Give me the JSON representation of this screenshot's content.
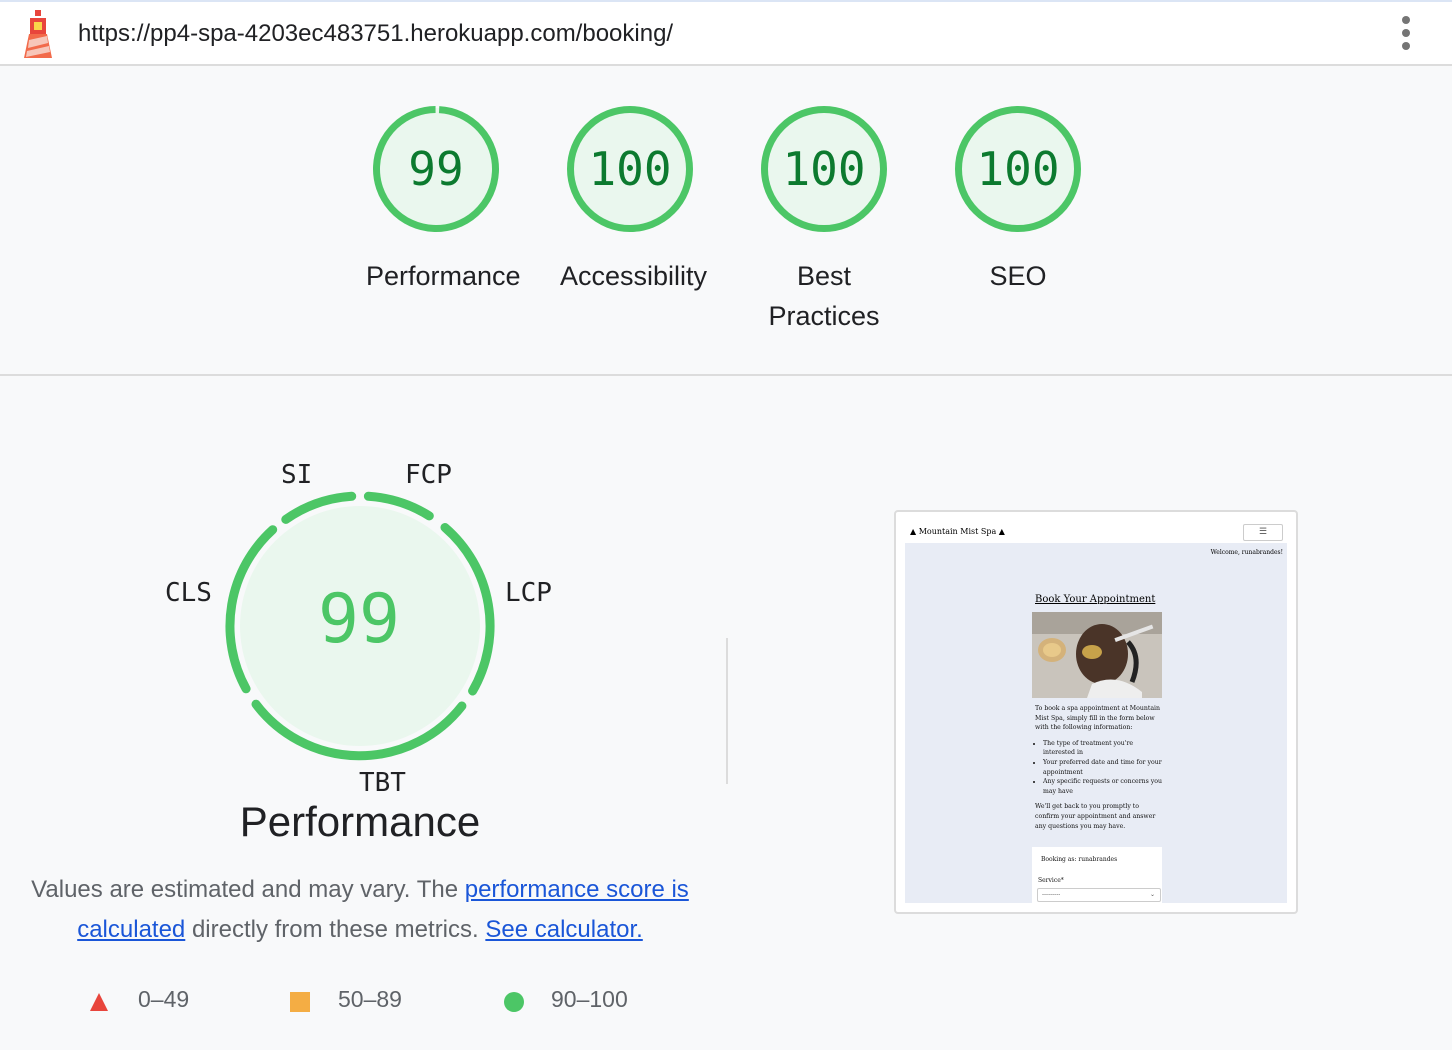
{
  "header": {
    "url": "https://pp4-spa-4203ec483751.herokuapp.com/booking/",
    "logo_icon": "lighthouse-icon",
    "menu_icon": "more-vert-icon"
  },
  "scores": [
    {
      "value": 99,
      "label": "Performance"
    },
    {
      "value": 100,
      "label": "Accessibility"
    },
    {
      "value": 100,
      "label": "Best Practices"
    },
    {
      "value": 100,
      "label": "SEO"
    }
  ],
  "colors": {
    "pass": "#4cc666",
    "pass_text": "#0c7a2f",
    "pass_fill": "#eaf7ee",
    "link": "#1a56d8",
    "fail": "#e8453c",
    "average": "#f4ad44"
  },
  "performance": {
    "score": 99,
    "title": "Performance",
    "metrics": {
      "si": "SI",
      "fcp": "FCP",
      "lcp": "LCP",
      "tbt": "TBT",
      "cls": "CLS"
    },
    "description": {
      "before": "Values are estimated and may vary. The ",
      "link1": "performance score is calculated",
      "middle": " directly from these metrics. ",
      "link2": "See calculator."
    }
  },
  "legend": [
    {
      "range": "0–49",
      "shape": "triangle"
    },
    {
      "range": "50–89",
      "shape": "square"
    },
    {
      "range": "90–100",
      "shape": "circle"
    }
  ],
  "screenshot": {
    "brand": "Mountain Mist Spa",
    "menu_glyph": "☰",
    "welcome": "Welcome, runabrandes!",
    "heading": "Book Your Appointment",
    "intro": "To book a spa appointment at Mountain Mist Spa, simply fill in the form below with the following information:",
    "bullets": [
      "The type of treatment you're interested in",
      "Your preferred date and time for your appointment",
      "Any specific requests or concerns you may have"
    ],
    "outro": "We'll get back to you promptly to confirm your appointment and answer any questions you may have.",
    "booking_as": "Booking as: runabrandes",
    "service_label": "Service*",
    "service_value": "---------"
  }
}
